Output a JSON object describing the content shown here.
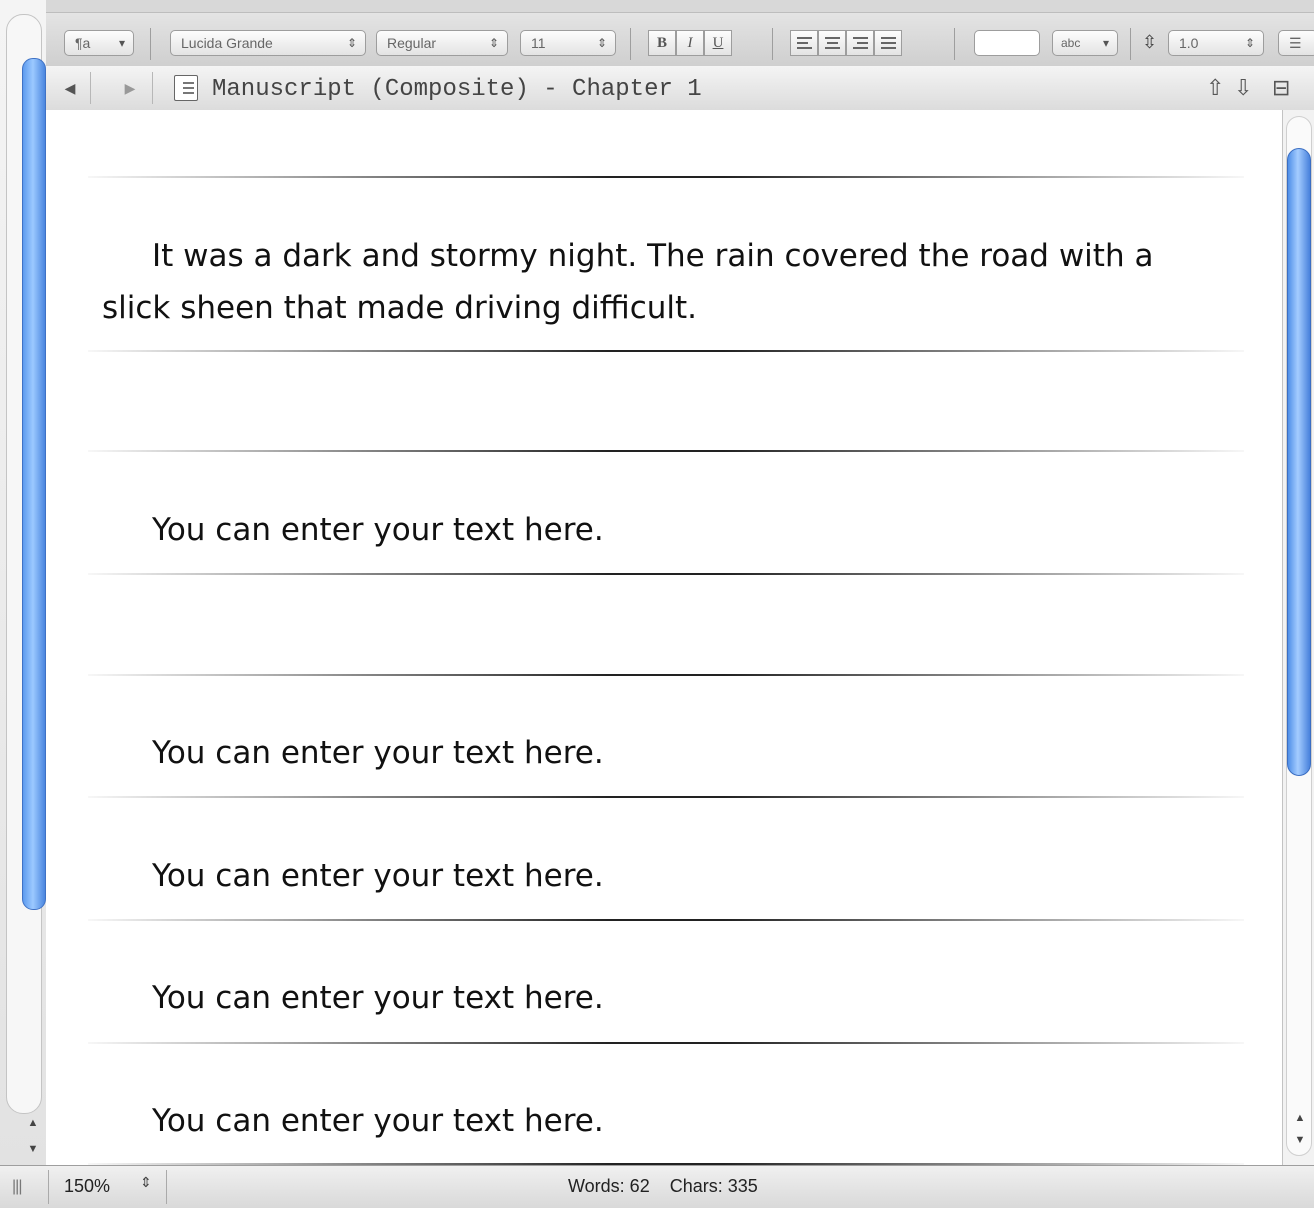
{
  "toolbar": {
    "paragraph_style": "¶a",
    "font_family": "Lucida Grande",
    "font_style": "Regular",
    "font_size": "11",
    "bold": "B",
    "italic": "I",
    "underline": "U",
    "highlight_label": "abc",
    "line_spacing": "1.0"
  },
  "header": {
    "back_icon": "back-arrow-icon",
    "forward_icon": "forward-arrow-icon",
    "title": "Manuscript (Composite) - Chapter 1",
    "up_arrow": "⇧",
    "down_arrow": "⇩",
    "split": "⊟"
  },
  "document": {
    "paragraphs": [
      "It was a dark and stormy night.  The rain covered the road with a slick sheen that made driving difficult.",
      "You can enter your text here.",
      "You can enter your text here.",
      "You can enter your text here.",
      "You can enter your text here.",
      "You can enter your text here."
    ]
  },
  "status": {
    "zoom": "150%",
    "words": "Words: 62",
    "chars": "Chars: 335"
  },
  "colors": {
    "scroll_thumb": "#5d9bef",
    "page": "#ffffff"
  }
}
